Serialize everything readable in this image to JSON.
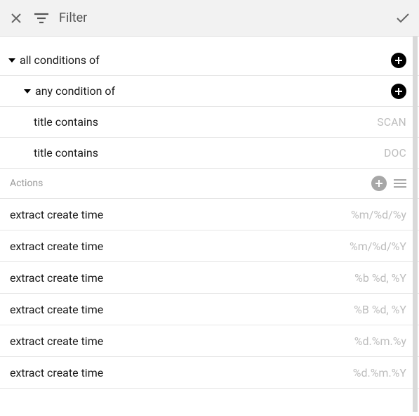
{
  "header": {
    "title": "Filter"
  },
  "filter": {
    "root": {
      "label": "all conditions of",
      "child": {
        "label": "any condition of",
        "conditions": [
          {
            "label": "title contains",
            "value": "SCAN"
          },
          {
            "label": "title contains",
            "value": "DOC"
          }
        ]
      }
    }
  },
  "actions_section": {
    "label": "Actions"
  },
  "actions": [
    {
      "label": "extract create time",
      "value": "%m/%d/%y"
    },
    {
      "label": "extract create time",
      "value": "%m/%d/%Y"
    },
    {
      "label": "extract create time",
      "value": "%b %d, %Y"
    },
    {
      "label": "extract create time",
      "value": "%B %d, %Y"
    },
    {
      "label": "extract create time",
      "value": "%d.%m.%y"
    },
    {
      "label": "extract create time",
      "value": "%d.%m.%Y"
    }
  ]
}
